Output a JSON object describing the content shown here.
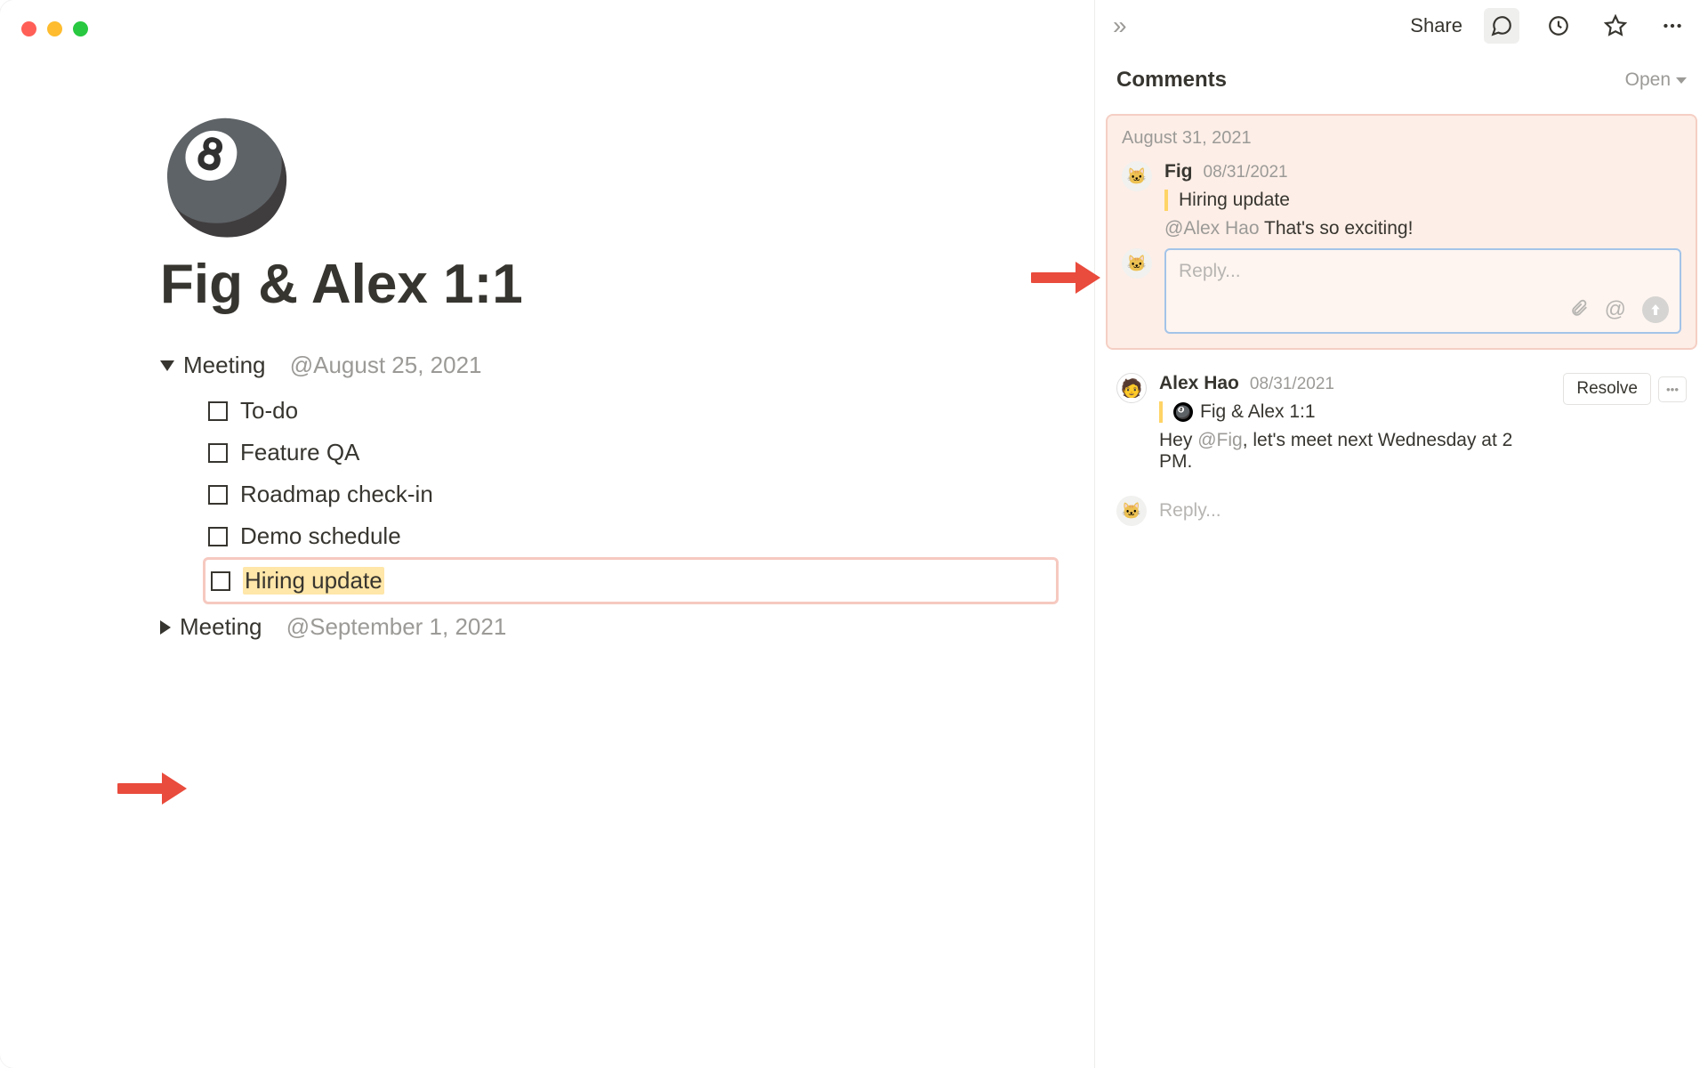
{
  "window": {
    "traffic_lights": [
      "close",
      "minimize",
      "zoom"
    ]
  },
  "topbar": {
    "expand_icon": "»",
    "share_label": "Share",
    "icons": {
      "comments": "comments-icon",
      "updates": "clock-icon",
      "favorite": "star-icon",
      "more": "dots-icon"
    }
  },
  "page": {
    "icon": "🎱",
    "title": "Fig & Alex 1:1",
    "blocks": [
      {
        "type": "toggle",
        "expanded": true,
        "label": "Meeting",
        "date_mention": "@August 25, 2021",
        "children": [
          {
            "type": "todo",
            "label": "To-do",
            "checked": false,
            "highlighted": false
          },
          {
            "type": "todo",
            "label": "Feature QA",
            "checked": false,
            "highlighted": false
          },
          {
            "type": "todo",
            "label": "Roadmap check-in",
            "checked": false,
            "highlighted": false
          },
          {
            "type": "todo",
            "label": "Demo schedule",
            "checked": false,
            "highlighted": false
          },
          {
            "type": "todo",
            "label": "Hiring update",
            "checked": false,
            "highlighted": true
          }
        ]
      },
      {
        "type": "toggle",
        "expanded": false,
        "label": "Meeting",
        "date_mention": "@September 1, 2021",
        "children": []
      }
    ]
  },
  "comments_panel": {
    "title": "Comments",
    "filter_label": "Open",
    "threads": [
      {
        "active": true,
        "date_header": "August 31, 2021",
        "comments": [
          {
            "author": "Fig",
            "timestamp": "08/31/2021",
            "avatar": "fig",
            "quote_text": "Hiring update",
            "mention": "@Alex Hao",
            "text": "That's so exciting!"
          }
        ],
        "reply": {
          "placeholder": "Reply...",
          "avatar": "fig",
          "tools": {
            "attach": "paperclip-icon",
            "mention": "@",
            "send": "arrow-up-icon"
          }
        }
      },
      {
        "active": false,
        "comments": [
          {
            "author": "Alex Hao",
            "timestamp": "08/31/2021",
            "avatar": "alex",
            "quote_icon": "🎱",
            "quote_text": "Fig & Alex 1:1",
            "text_prefix": "Hey ",
            "mention": "@Fig",
            "text_suffix": ", let's meet next Wednesday at 2 PM."
          }
        ],
        "resolve_label": "Resolve",
        "reply_placeholder": "Reply...",
        "reply_avatar": "fig"
      }
    ]
  },
  "annotations": {
    "arrow_color": "#e94b3c"
  }
}
